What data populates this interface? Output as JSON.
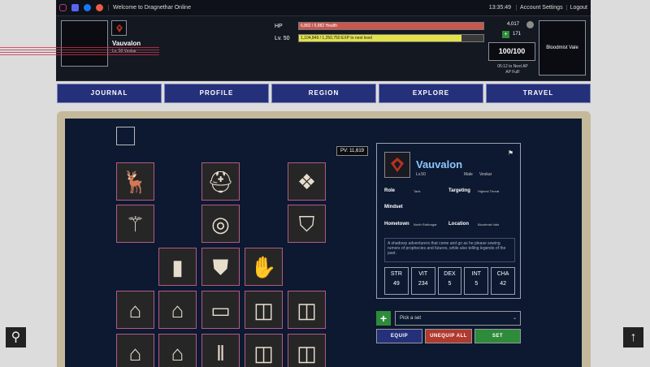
{
  "topbar": {
    "welcome": "Welcome to Dragnethar Online",
    "clock": "13:35:49",
    "account_settings": "Account Settings",
    "logout": "Logout",
    "social": [
      {
        "name": "instagram-icon",
        "color": "#c13584"
      },
      {
        "name": "discord-icon",
        "color": "#5865f2"
      },
      {
        "name": "facebook-icon",
        "color": "#1877f2"
      },
      {
        "name": "patreon-icon",
        "color": "#e85b46"
      }
    ]
  },
  "header": {
    "player_name": "Vauvalon",
    "player_sub": "Lv. 50 Veskar",
    "hp_label": "HP",
    "hp_text": "6,882 / 6,882 Health",
    "hp_fraction": 1.0,
    "level_label": "Lv. 50",
    "exp_text": "1,104,849 / 1,250,750 EXP to next level",
    "exp_fraction": 0.883,
    "gold": "4,017",
    "gems": "171",
    "ap": "100/100",
    "ap_next": "05:12 to Next AP",
    "ap_full": "AP Full!",
    "region": "Bloodmist Vale"
  },
  "nav": [
    "JOURNAL",
    "PROFILE",
    "REGION",
    "EXPLORE",
    "TRAVEL"
  ],
  "pv": "PV: 11,619",
  "equipment": [
    {
      "icon": "stag-icon",
      "glyph": "🦌"
    },
    {
      "icon": "helmet-icon",
      "glyph": "⛑"
    },
    {
      "icon": "shard-orb-icon",
      "glyph": "❖"
    },
    {
      "icon": "mace-icon",
      "glyph": "⚚"
    },
    {
      "icon": "amulet-icon",
      "glyph": "◎"
    },
    {
      "icon": "shield-icon",
      "glyph": "⛉"
    },
    {
      "icon": "bracers-icon",
      "glyph": "▮"
    },
    {
      "icon": "armor-icon",
      "glyph": "⛊"
    },
    {
      "icon": "gloves-icon",
      "glyph": "✋"
    },
    {
      "icon": "tag-icon",
      "glyph": "⌂"
    },
    {
      "icon": "tag-icon",
      "glyph": "⌂"
    },
    {
      "icon": "belt-icon",
      "glyph": "▭"
    },
    {
      "icon": "band-icon",
      "glyph": "◫"
    },
    {
      "icon": "band-icon",
      "glyph": "◫"
    },
    {
      "icon": "tag-icon",
      "glyph": "⌂"
    },
    {
      "icon": "tag-icon",
      "glyph": "⌂"
    },
    {
      "icon": "pants-icon",
      "glyph": "‖"
    },
    {
      "icon": "band-icon",
      "glyph": "◫"
    },
    {
      "icon": "band-icon",
      "glyph": "◫"
    }
  ],
  "card": {
    "name": "Vauvalon",
    "level": "Lv.50",
    "gender": "Male",
    "race": "Veskar",
    "role_label": "Role",
    "role": "Tank",
    "targeting_label": "Targeting",
    "targeting": "Highest Threat",
    "mindset_label": "Mindset",
    "hometown_label": "Hometown",
    "hometown": "North Rothragar",
    "location_label": "Location",
    "location": "Bloodmist Vale",
    "description": "A shadowy adventurers that come and go as he please sowing rumors of prophecies and futures, while also telling legends of the past.",
    "stats": [
      {
        "label": "STR",
        "value": "49"
      },
      {
        "label": "VIT",
        "value": "234"
      },
      {
        "label": "DEX",
        "value": "5"
      },
      {
        "label": "INT",
        "value": "5"
      },
      {
        "label": "CHA",
        "value": "42"
      }
    ]
  },
  "sets": {
    "placeholder": "Pick a set",
    "equip": "EQUIP",
    "unequip_all": "UNEQUIP ALL",
    "set": "SET"
  }
}
